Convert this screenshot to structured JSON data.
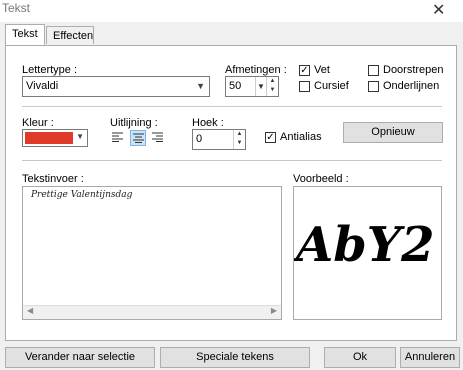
{
  "window": {
    "title": "Tekst",
    "close_glyph": "✕"
  },
  "tabs": [
    {
      "label": "Tekst",
      "active": true
    },
    {
      "label": "Effecten",
      "active": false
    }
  ],
  "font": {
    "label": "Lettertype :",
    "value": "Vivaldi"
  },
  "size": {
    "label": "Afmetingen :",
    "value": "50"
  },
  "styles": {
    "bold": {
      "label": "Vet",
      "checked": true
    },
    "italic": {
      "label": "Cursief",
      "checked": false
    },
    "strikethrough": {
      "label": "Doorstrepen",
      "checked": false
    },
    "underline": {
      "label": "Onderlijnen",
      "checked": false
    }
  },
  "color": {
    "label": "Kleur :",
    "value": "#e03a2a"
  },
  "alignment": {
    "label": "Uitlijning :",
    "selected": "center"
  },
  "angle": {
    "label": "Hoek :",
    "value": "0"
  },
  "antialias": {
    "label": "Antialias",
    "checked": true
  },
  "reset_button": "Opnieuw",
  "text_input": {
    "label": "Tekstinvoer :",
    "value": "Prettige Valentijnsdag"
  },
  "preview": {
    "label": "Voorbeeld :",
    "sample": "AbY2"
  },
  "footer": {
    "change_selection": "Verander naar selectie",
    "special_chars": "Speciale tekens",
    "ok": "Ok",
    "cancel": "Annuleren"
  }
}
